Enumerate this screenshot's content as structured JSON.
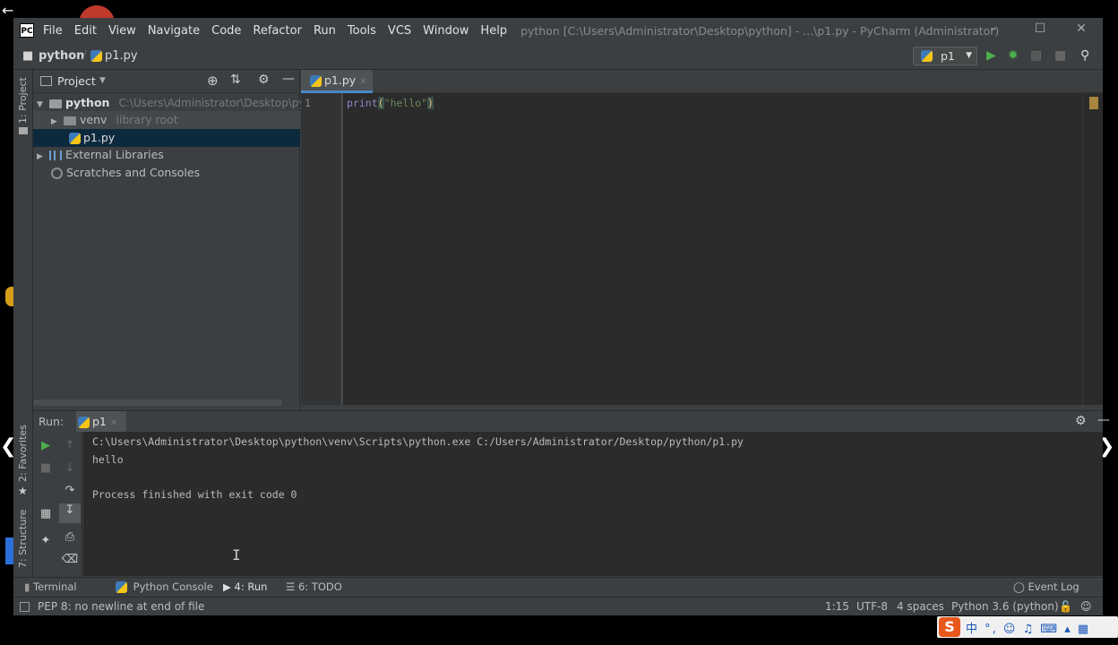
{
  "menu": [
    "File",
    "Edit",
    "View",
    "Navigate",
    "Code",
    "Refactor",
    "Run",
    "Tools",
    "VCS",
    "Window",
    "Help"
  ],
  "window_title": "python [C:\\Users\\Administrator\\Desktop\\python] - ...\\p1.py - PyCharm (Administrator)",
  "app_icon_text": "PC",
  "breadcrumb": {
    "project": "python",
    "file": "p1.py"
  },
  "run_config": {
    "selected": "p1"
  },
  "left_strip": {
    "project": "1: Project",
    "favorites": "2: Favorites",
    "structure": "7: Structure"
  },
  "project_pane": {
    "title": "Project",
    "tree": {
      "root_name": "python",
      "root_path": "C:\\Users\\Administrator\\Desktop\\pyth",
      "venv_name": "venv",
      "venv_hint": "library root",
      "file": "p1.py",
      "external": "External Libraries",
      "scratches": "Scratches and Consoles"
    }
  },
  "editor": {
    "tab": "p1.py",
    "line_number": "1",
    "code": {
      "func": "print",
      "open": "(",
      "string": "\"hello\"",
      "close": ")"
    }
  },
  "run_panel": {
    "label": "Run:",
    "tab": "p1",
    "console": [
      "C:\\Users\\Administrator\\Desktop\\python\\venv\\Scripts\\python.exe C:/Users/Administrator/Desktop/python/p1.py",
      "hello",
      "",
      "Process finished with exit code 0"
    ]
  },
  "bottom_tabs": {
    "terminal": "Terminal",
    "python_console": "Python Console",
    "run": "4: Run",
    "todo": "6: TODO",
    "event_log": "Event Log"
  },
  "status": {
    "message": "PEP 8: no newline at end of file",
    "position": "1:15",
    "encoding": "UTF-8",
    "indent": "4 spaces",
    "interpreter": "Python 3.6 (python)"
  },
  "ime": {
    "logo": "S",
    "text": "中 °, ☺ ♫ ⌨ ▴ ▦"
  }
}
